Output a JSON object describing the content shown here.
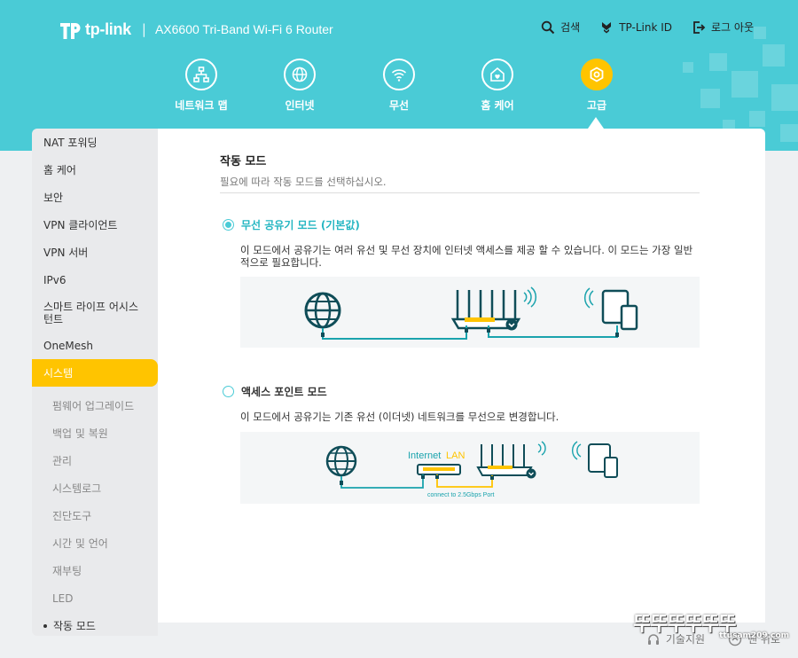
{
  "header": {
    "brand": "tp-link",
    "separator": "|",
    "model": "AX6600 Tri-Band Wi-Fi 6 Router",
    "links": [
      {
        "label": "검색",
        "icon": "search-icon"
      },
      {
        "label": "TP-Link ID",
        "icon": "tplink-id-icon"
      },
      {
        "label": "로그 아웃",
        "icon": "logout-icon"
      }
    ]
  },
  "nav": {
    "items": [
      {
        "label": "네트워크 맵",
        "icon": "network-map-icon"
      },
      {
        "label": "인터넷",
        "icon": "globe-icon"
      },
      {
        "label": "무선",
        "icon": "wifi-icon"
      },
      {
        "label": "홈 케어",
        "icon": "home-care-icon"
      },
      {
        "label": "고급",
        "icon": "gear-icon",
        "active": true
      }
    ]
  },
  "sidebar": {
    "items": [
      "NAT 포워딩",
      "홈 케어",
      "보안",
      "VPN 클라이언트",
      "VPN 서버",
      "IPv6",
      "스마트 라이프 어시스턴트",
      "OneMesh",
      "시스템"
    ],
    "active_item": "시스템",
    "subitems": [
      "펌웨어 업그레이드",
      "백업 및 복원",
      "관리",
      "시스템로그",
      "진단도구",
      "시간 및 언어",
      "재부팅",
      "LED",
      "작동 모드"
    ],
    "current_subitem": "작동 모드"
  },
  "main": {
    "title": "작동 모드",
    "description": "필요에 따라 작동 모드를 선택하십시오.",
    "modes": [
      {
        "label": "무선 공유기 모드 (기본값)",
        "selected": true,
        "description": "이 모드에서 공유기는 여러 유선 및 무선 장치에 인터넷 액세스를 제공 할 수 있습니다. 이 모드는 가장 일반적으로 필요합니다."
      },
      {
        "label": "액세스 포인트 모드",
        "selected": false,
        "description": "이 모드에서 공유기는 기존 유선 (이더넷) 네트워크를 무선으로 변경합니다.",
        "diagram_label_internet": "Internet",
        "diagram_label_lan": "LAN",
        "diagram_caption": "connect to 2.5Gbps Port"
      }
    ]
  },
  "footer": {
    "links": [
      "기술지원",
      "맨 위로"
    ]
  },
  "watermark": {
    "text": "뚜뚜뚜뚜뚜뚜",
    "url": "ttusam209.com"
  },
  "colors": {
    "header": "#4acbd6",
    "accent": "#ffc400",
    "diagram_teal": "#0f4d58",
    "diagram_line": "#1aa3ad"
  }
}
